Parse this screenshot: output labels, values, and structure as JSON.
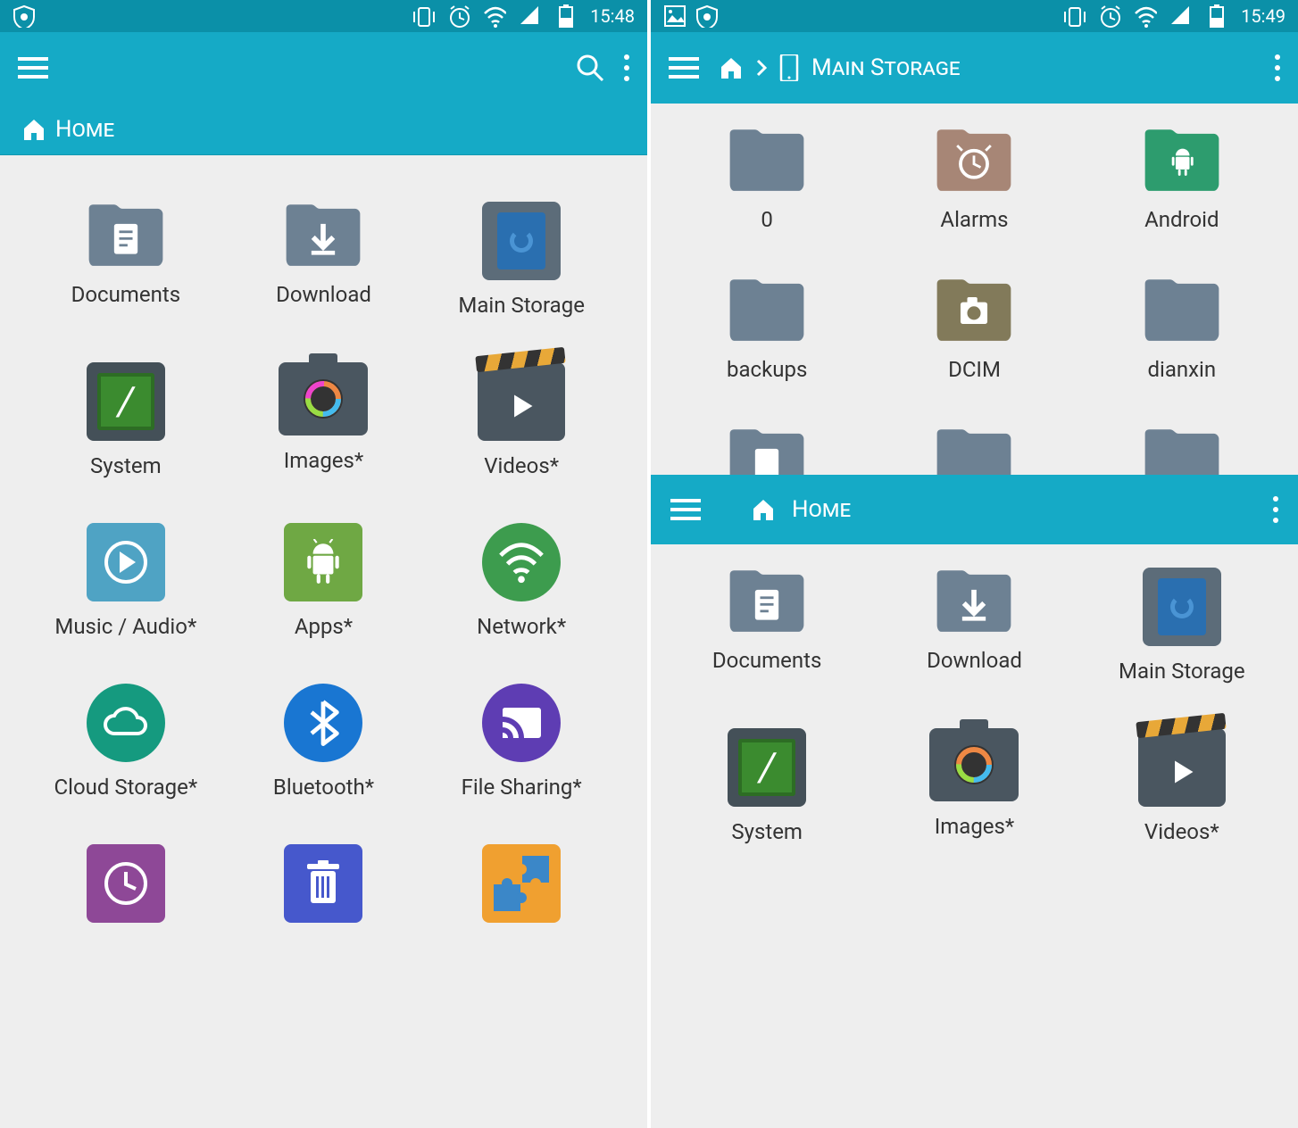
{
  "statusbar": {
    "left_time": "15:48",
    "right_time": "15:49"
  },
  "left": {
    "header_home": "Home",
    "items": [
      {
        "label": "Documents"
      },
      {
        "label": "Download"
      },
      {
        "label": "Main Storage"
      },
      {
        "label": "System"
      },
      {
        "label": "Images*"
      },
      {
        "label": "Videos*"
      },
      {
        "label": "Music / Audio*"
      },
      {
        "label": "Apps*"
      },
      {
        "label": "Network*"
      },
      {
        "label": "Cloud Storage*"
      },
      {
        "label": "Bluetooth*"
      },
      {
        "label": "File Sharing*"
      }
    ]
  },
  "right_top": {
    "crumb_main": "Main Storage",
    "items": [
      {
        "label": "0"
      },
      {
        "label": "Alarms"
      },
      {
        "label": "Android"
      },
      {
        "label": "backups"
      },
      {
        "label": "DCIM"
      },
      {
        "label": "dianxin"
      }
    ]
  },
  "right_bottom": {
    "header_home": "Home",
    "items": [
      {
        "label": "Documents"
      },
      {
        "label": "Download"
      },
      {
        "label": "Main Storage"
      },
      {
        "label": "System"
      },
      {
        "label": "Images*"
      },
      {
        "label": "Videos*"
      }
    ]
  }
}
